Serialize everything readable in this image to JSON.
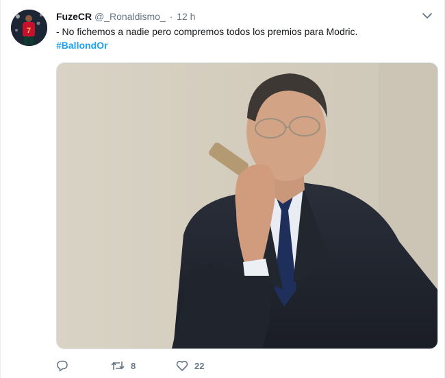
{
  "tweet": {
    "author": {
      "name": "FuzeCR",
      "handle": "@_Ronaldismo_",
      "separator": "·",
      "time": "12 h",
      "avatar_shirt_number": "7"
    },
    "text_line": "- No fichemos a nadie pero compremos todos los premios para Modric.",
    "hashtag": "#BallondOr",
    "media": {
      "kind": "photo"
    },
    "stats": {
      "retweets": "8",
      "likes": "22"
    }
  },
  "icons": {
    "menu": "chevron-down-icon",
    "reply": "reply-icon",
    "retweet": "retweet-icon",
    "like": "heart-icon"
  },
  "colors": {
    "link": "#1da1f2",
    "text": "#14171a",
    "secondary": "#657786"
  }
}
